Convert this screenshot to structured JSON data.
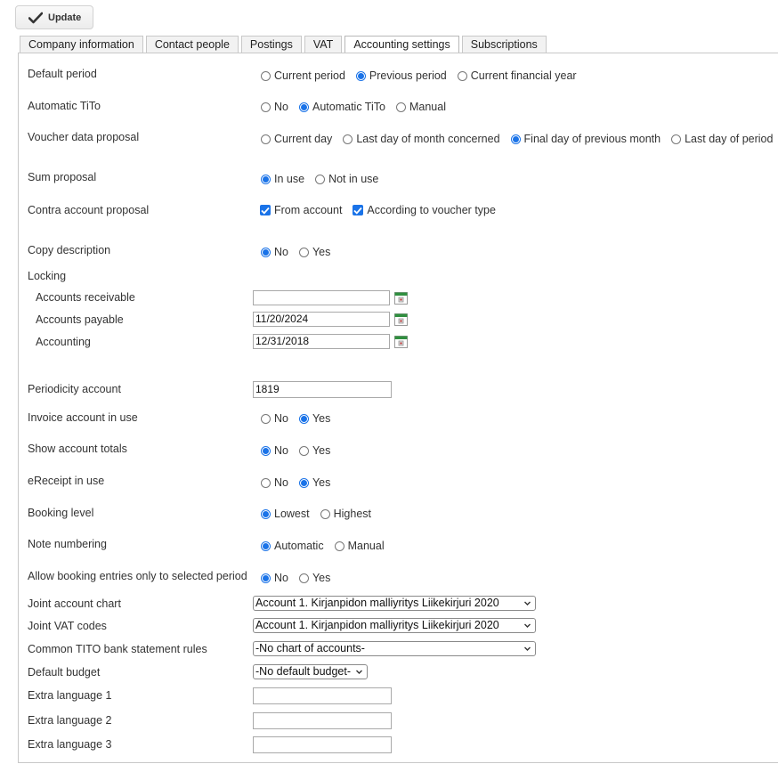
{
  "toolbar": {
    "update_label": "Update"
  },
  "tabs": [
    "Company information",
    "Contact people",
    "Postings",
    "VAT",
    "Accounting settings",
    "Subscriptions"
  ],
  "active_tab": "Accounting settings",
  "settings": {
    "default_period": {
      "label": "Default period",
      "options": [
        "Current period",
        "Previous period",
        "Current financial year"
      ],
      "selected": "Previous period"
    },
    "automatic_tito": {
      "label": "Automatic TiTo",
      "options": [
        "No",
        "Automatic TiTo",
        "Manual"
      ],
      "selected": "Automatic TiTo"
    },
    "voucher_data_proposal": {
      "label": "Voucher data proposal",
      "options": [
        "Current day",
        "Last day of month concerned",
        "Final day of previous month",
        "Last day of period"
      ],
      "selected": "Final day of previous month"
    },
    "sum_proposal": {
      "label": "Sum proposal",
      "options": [
        "In use",
        "Not in use"
      ],
      "selected": "In use"
    },
    "contra_account_proposal": {
      "label": "Contra account proposal",
      "checkboxes": [
        {
          "label": "From account",
          "checked": true
        },
        {
          "label": "According to voucher type",
          "checked": true
        }
      ]
    },
    "copy_description": {
      "label": "Copy description",
      "options": [
        "No",
        "Yes"
      ],
      "selected": "No"
    },
    "locking": {
      "label": "Locking",
      "accounts_receivable": {
        "label": "Accounts receivable",
        "value": ""
      },
      "accounts_payable": {
        "label": "Accounts payable",
        "value": "11/20/2024"
      },
      "accounting": {
        "label": "Accounting",
        "value": "12/31/2018"
      }
    },
    "periodicity_account": {
      "label": "Periodicity account",
      "value": "1819"
    },
    "invoice_account_in_use": {
      "label": "Invoice account in use",
      "options": [
        "No",
        "Yes"
      ],
      "selected": "Yes"
    },
    "show_account_totals": {
      "label": "Show account totals",
      "options": [
        "No",
        "Yes"
      ],
      "selected": "No"
    },
    "ereceipt_in_use": {
      "label": "eReceipt in use",
      "options": [
        "No",
        "Yes"
      ],
      "selected": "Yes"
    },
    "booking_level": {
      "label": "Booking level",
      "options": [
        "Lowest",
        "Highest"
      ],
      "selected": "Lowest"
    },
    "note_numbering": {
      "label": "Note numbering",
      "options": [
        "Automatic",
        "Manual"
      ],
      "selected": "Automatic"
    },
    "allow_booking_selected_period": {
      "label": "Allow booking entries only to selected period",
      "options": [
        "No",
        "Yes"
      ],
      "selected": "No"
    },
    "joint_account_chart": {
      "label": "Joint account chart",
      "value": "Account 1. Kirjanpidon malliyritys Liikekirjuri 2020"
    },
    "joint_vat_codes": {
      "label": "Joint VAT codes",
      "value": "Account 1. Kirjanpidon malliyritys Liikekirjuri 2020"
    },
    "common_tito_rules": {
      "label": "Common TITO bank statement rules",
      "value": "-No chart of accounts-"
    },
    "default_budget": {
      "label": "Default budget",
      "value": "-No default budget-"
    },
    "extra_language_1": {
      "label": "Extra language 1",
      "value": ""
    },
    "extra_language_2": {
      "label": "Extra language 2",
      "value": ""
    },
    "extra_language_3": {
      "label": "Extra language 3",
      "value": ""
    }
  },
  "colors": {
    "accent": "#1a73e8",
    "border": "#c8c8c8",
    "tab_bg": "#f2f2f2"
  },
  "icons": {
    "update": "checkmark-icon",
    "calendar": "calendar-icon",
    "select": "chevron-down-icon"
  }
}
